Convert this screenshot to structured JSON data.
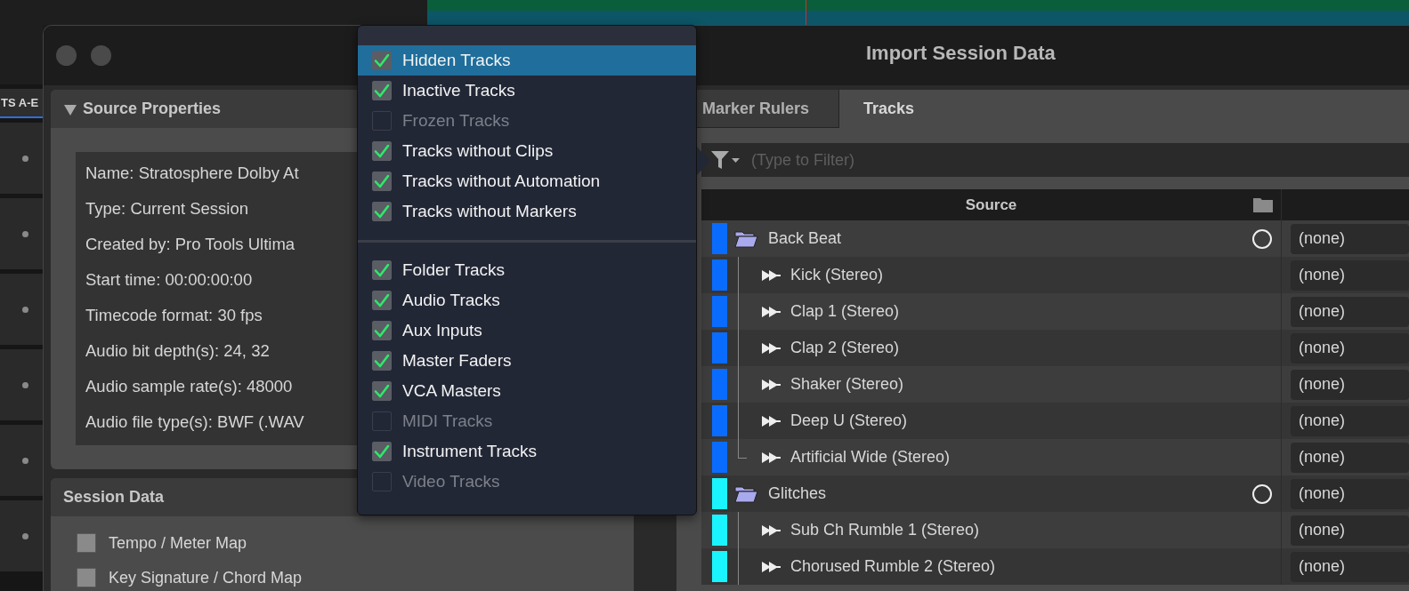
{
  "background": {
    "track_label": "TS A-E"
  },
  "window": {
    "title": "Import Session Data"
  },
  "source_properties": {
    "title": "Source Properties",
    "expanded": true,
    "lines": [
      "Name: Stratosphere Dolby At",
      "Type: Current Session",
      "Created by: Pro Tools Ultima",
      "Start time: 00:00:00:00",
      "Timecode format: 30 fps",
      "Audio bit depth(s): 24, 32",
      "Audio sample rate(s): 48000",
      "Audio file type(s): BWF (.WAV"
    ]
  },
  "session_data": {
    "title": "Session Data",
    "items": [
      {
        "label": "Tempo / Meter Map",
        "checked": false
      },
      {
        "label": "Key Signature / Chord Map",
        "checked": false
      }
    ]
  },
  "tabs": [
    {
      "label": "Marker Rulers",
      "selected": false
    },
    {
      "label": "Tracks",
      "selected": true
    }
  ],
  "filter": {
    "placeholder": "(Type to Filter)"
  },
  "table": {
    "columns": [
      "Source"
    ],
    "rows": [
      {
        "name": "Back Beat",
        "color": "#0a6cff",
        "destination": "(none)",
        "children": [
          {
            "name": "Kick (Stereo)",
            "color": "#0a6cff",
            "destination": "(none)"
          },
          {
            "name": "Clap 1 (Stereo)",
            "color": "#0a6cff",
            "destination": "(none)"
          },
          {
            "name": "Clap 2 (Stereo)",
            "color": "#0a6cff",
            "destination": "(none)"
          },
          {
            "name": "Shaker (Stereo)",
            "color": "#0a6cff",
            "destination": "(none)"
          },
          {
            "name": "Deep U (Stereo)",
            "color": "#0a6cff",
            "destination": "(none)"
          },
          {
            "name": "Artificial Wide (Stereo)",
            "color": "#0a6cff",
            "destination": "(none)"
          }
        ]
      },
      {
        "name": "Glitches",
        "color": "#19f4ff",
        "destination": "(none)",
        "children": [
          {
            "name": "Sub Ch Rumble 1 (Stereo)",
            "color": "#19f4ff",
            "destination": "(none)"
          },
          {
            "name": "Chorused Rumble 2 (Stereo)",
            "color": "#19f4ff",
            "destination": "(none)"
          }
        ]
      }
    ]
  },
  "filter_menu": {
    "groups": [
      [
        {
          "label": "Hidden Tracks",
          "checked": true,
          "highlighted": true
        },
        {
          "label": "Inactive Tracks",
          "checked": true,
          "highlighted": false
        },
        {
          "label": "Frozen Tracks",
          "checked": false,
          "highlighted": false
        },
        {
          "label": "Tracks without Clips",
          "checked": true,
          "highlighted": false
        },
        {
          "label": "Tracks without Automation",
          "checked": true,
          "highlighted": false
        },
        {
          "label": "Tracks without Markers",
          "checked": true,
          "highlighted": false
        }
      ],
      [
        {
          "label": "Folder Tracks",
          "checked": true,
          "highlighted": false
        },
        {
          "label": "Audio Tracks",
          "checked": true,
          "highlighted": false
        },
        {
          "label": "Aux Inputs",
          "checked": true,
          "highlighted": false
        },
        {
          "label": "Master Faders",
          "checked": true,
          "highlighted": false
        },
        {
          "label": "VCA Masters",
          "checked": true,
          "highlighted": false
        },
        {
          "label": "MIDI Tracks",
          "checked": false,
          "highlighted": false
        },
        {
          "label": "Instrument Tracks",
          "checked": true,
          "highlighted": false
        },
        {
          "label": "Video Tracks",
          "checked": false,
          "highlighted": false
        }
      ]
    ]
  }
}
